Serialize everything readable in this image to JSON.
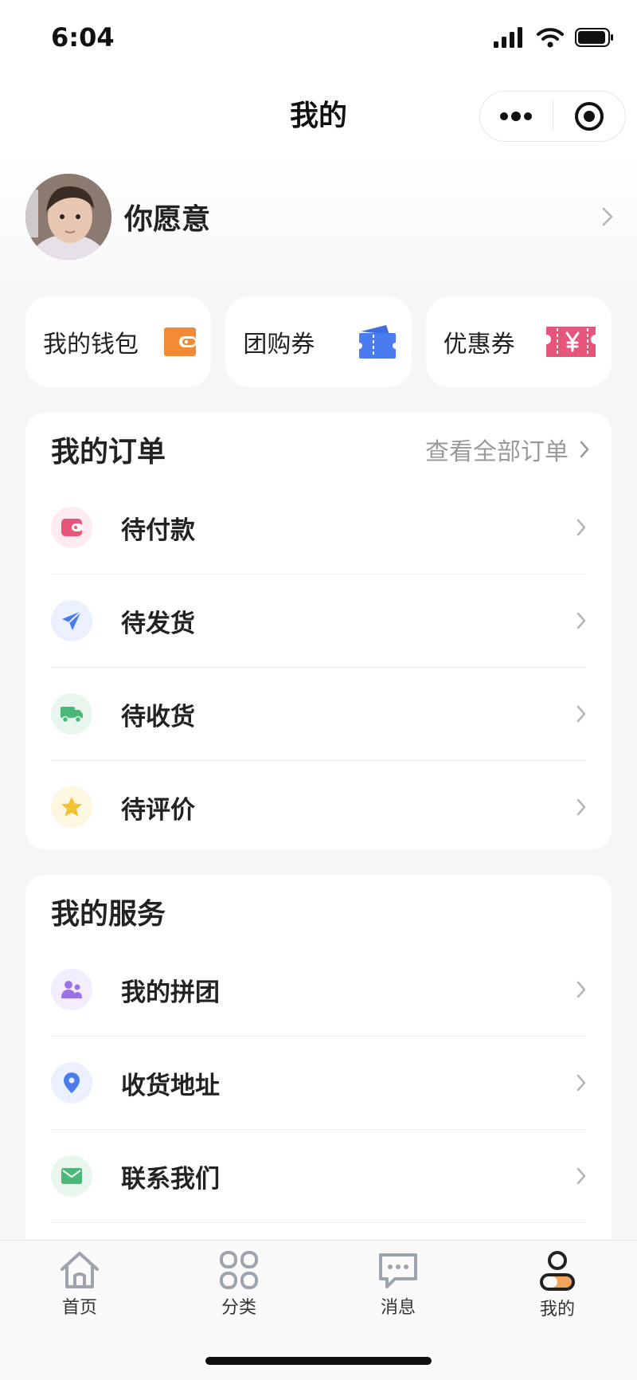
{
  "status_bar": {
    "time": "6:04"
  },
  "nav": {
    "title": "我的",
    "more_icon": "more-dots-icon",
    "close_icon": "target-circle-icon"
  },
  "profile": {
    "username": "你愿意"
  },
  "quick_links": [
    {
      "label": "我的钱包",
      "icon": "wallet-icon",
      "color": "#f08a35"
    },
    {
      "label": "团购券",
      "icon": "ticket-icon",
      "color": "#4a7cf0"
    },
    {
      "label": "优惠券",
      "icon": "coupon-yen-icon",
      "color": "#e8557a"
    }
  ],
  "orders": {
    "title": "我的订单",
    "view_all": "查看全部订单",
    "items": [
      {
        "label": "待付款",
        "icon": "wallet-icon",
        "color": "#e8557a",
        "bg": "#fdecef"
      },
      {
        "label": "待发货",
        "icon": "paper-plane-icon",
        "color": "#4a7cf0",
        "bg": "#eaf0fe"
      },
      {
        "label": "待收货",
        "icon": "truck-icon",
        "color": "#4bb87a",
        "bg": "#e8f6ee"
      },
      {
        "label": "待评价",
        "icon": "star-icon",
        "color": "#f2c230",
        "bg": "#fdf6e1"
      }
    ]
  },
  "services": {
    "title": "我的服务",
    "items": [
      {
        "label": "我的拼团",
        "icon": "group-users-icon",
        "color": "#9b73e8",
        "bg": "#f2edfd"
      },
      {
        "label": "收货地址",
        "icon": "location-pin-icon",
        "color": "#4a7cf0",
        "bg": "#eaf0fe"
      },
      {
        "label": "联系我们",
        "icon": "envelope-icon",
        "color": "#4bb87a",
        "bg": "#e8f6ee"
      }
    ]
  },
  "tab_bar": {
    "tabs": [
      {
        "label": "首页",
        "icon": "home-icon"
      },
      {
        "label": "分类",
        "icon": "grid-icon"
      },
      {
        "label": "消息",
        "icon": "chat-icon"
      },
      {
        "label": "我的",
        "icon": "user-icon",
        "active": true
      }
    ]
  }
}
